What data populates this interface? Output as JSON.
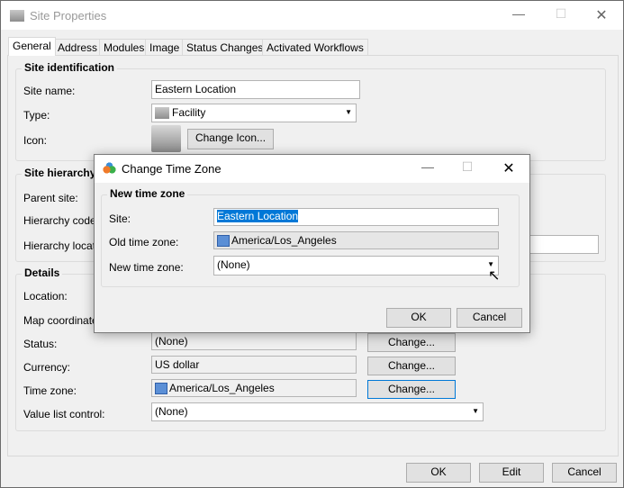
{
  "window": {
    "title": "Site Properties",
    "icon": "building-icon"
  },
  "tabs": [
    "General",
    "Address",
    "Modules",
    "Image",
    "Status Changes",
    "Activated Workflows"
  ],
  "site_identification": {
    "title": "Site identification",
    "site_name_label": "Site name:",
    "site_name": "Eastern Location",
    "type_label": "Type:",
    "type": "Facility",
    "icon_label": "Icon:",
    "change_icon": "Change Icon..."
  },
  "site_hierarchy": {
    "title": "Site hierarchy",
    "parent_label": "Parent site:",
    "code_label": "Hierarchy code:",
    "location_label": "Hierarchy locatio"
  },
  "details": {
    "title": "Details",
    "location_label": "Location:",
    "map_label": "Map coordinates",
    "status_label": "Status:",
    "status": "(None)",
    "currency_label": "Currency:",
    "currency": "US dollar",
    "timezone_label": "Time zone:",
    "timezone": "America/Los_Angeles",
    "value_list_label": "Value list control:",
    "value_list": "(None)",
    "change": "Change..."
  },
  "footer": {
    "ok": "OK",
    "edit": "Edit",
    "cancel": "Cancel"
  },
  "dialog": {
    "title": "Change Time Zone",
    "group": "New time zone",
    "site_label": "Site:",
    "site": "Eastern Location",
    "old_label": "Old time zone:",
    "old": "America/Los_Angeles",
    "new_label": "New time zone:",
    "new": "(None)",
    "ok": "OK",
    "cancel": "Cancel",
    "selection_color": "#0078d7"
  }
}
